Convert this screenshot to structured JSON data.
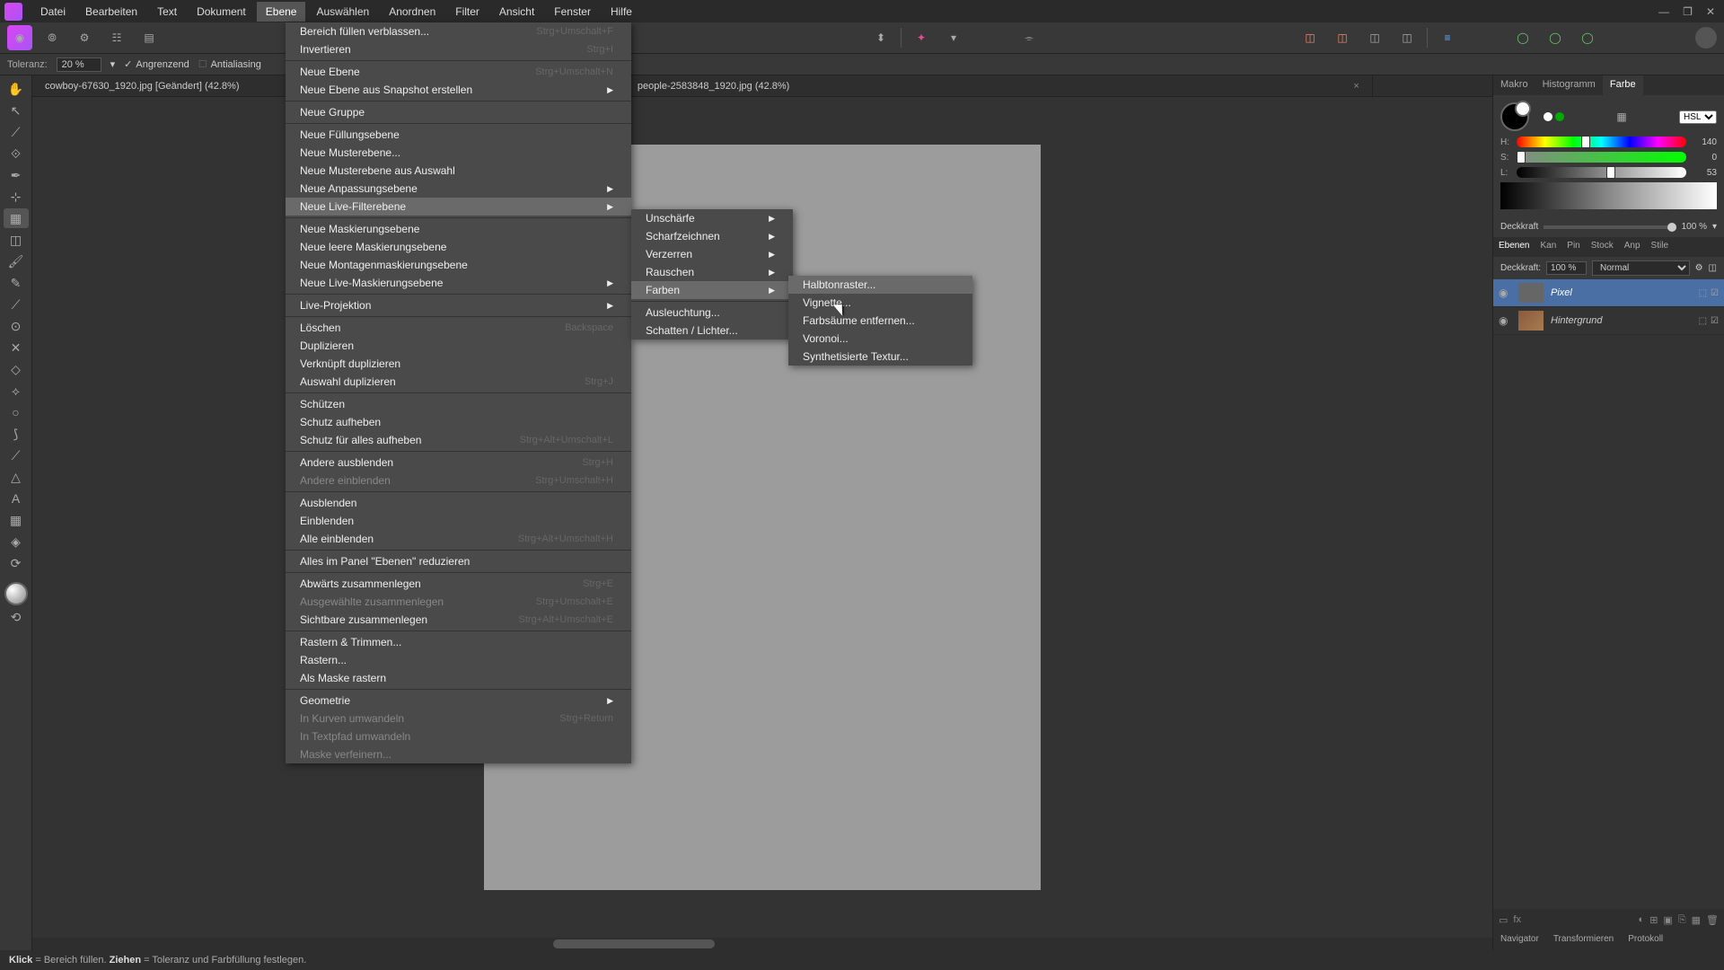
{
  "menubar": [
    "Datei",
    "Bearbeiten",
    "Text",
    "Dokument",
    "Ebene",
    "Auswählen",
    "Anordnen",
    "Filter",
    "Ansicht",
    "Fenster",
    "Hilfe"
  ],
  "active_menu_index": 4,
  "options": {
    "tolerance_label": "Toleranz:",
    "tolerance_value": "20 %",
    "contiguous": "Angrenzend",
    "antialias": "Antialiasing"
  },
  "tabs": [
    {
      "label": "cowboy-67630_1920.jpg [Geändert] (42.8%)"
    },
    {
      "label": "people-2583848_1920.jpg (42.8%)"
    }
  ],
  "right_tabs": [
    "Makro",
    "Histogramm",
    "Farbe"
  ],
  "color": {
    "mode": "HSL",
    "h": "140",
    "s": "0",
    "l": "53",
    "opacity_label": "Deckkraft",
    "opacity_value": "100 %"
  },
  "layer_tabs": [
    "Ebenen",
    "Kan",
    "Pin",
    "Stock",
    "Anp",
    "Stile"
  ],
  "layer_controls": {
    "opacity_label": "Deckkraft:",
    "opacity_value": "100 %",
    "blend": "Normal"
  },
  "layers": [
    {
      "name": "Pixel",
      "selected": true
    },
    {
      "name": "Hintergrund",
      "selected": false
    }
  ],
  "bottom_tabs": [
    "Navigator",
    "Transformieren",
    "Protokoll"
  ],
  "status": {
    "click": "Klick",
    "click_desc": "Bereich füllen.",
    "drag": "Ziehen",
    "drag_desc": "Toleranz und Farbfüllung festlegen."
  },
  "menu_ebene": [
    {
      "t": "item",
      "label": "Bereich füllen verblassen...",
      "sc": "Strg+Umschalt+F"
    },
    {
      "t": "item",
      "label": "Invertieren",
      "sc": "Strg+I"
    },
    {
      "t": "sep"
    },
    {
      "t": "item",
      "label": "Neue Ebene",
      "sc": "Strg+Umschalt+N"
    },
    {
      "t": "item",
      "label": "Neue Ebene aus Snapshot erstellen",
      "sub": true
    },
    {
      "t": "sep"
    },
    {
      "t": "item",
      "label": "Neue Gruppe"
    },
    {
      "t": "sep"
    },
    {
      "t": "item",
      "label": "Neue Füllungsebene"
    },
    {
      "t": "item",
      "label": "Neue Musterebene..."
    },
    {
      "t": "item",
      "label": "Neue Musterebene aus Auswahl"
    },
    {
      "t": "item",
      "label": "Neue Anpassungsebene",
      "sub": true
    },
    {
      "t": "item",
      "label": "Neue Live-Filterebene",
      "sub": true,
      "hov": true
    },
    {
      "t": "sep"
    },
    {
      "t": "item",
      "label": "Neue Maskierungsebene"
    },
    {
      "t": "item",
      "label": "Neue leere Maskierungsebene"
    },
    {
      "t": "item",
      "label": "Neue Montagenmaskierungsebene"
    },
    {
      "t": "item",
      "label": "Neue Live-Maskierungsebene",
      "sub": true
    },
    {
      "t": "sep"
    },
    {
      "t": "item",
      "label": "Live-Projektion",
      "sub": true
    },
    {
      "t": "sep"
    },
    {
      "t": "item",
      "label": "Löschen",
      "sc": "Backspace"
    },
    {
      "t": "item",
      "label": "Duplizieren"
    },
    {
      "t": "item",
      "label": "Verknüpft duplizieren"
    },
    {
      "t": "item",
      "label": "Auswahl duplizieren",
      "sc": "Strg+J"
    },
    {
      "t": "sep"
    },
    {
      "t": "item",
      "label": "Schützen"
    },
    {
      "t": "item",
      "label": "Schutz aufheben"
    },
    {
      "t": "item",
      "label": "Schutz für alles aufheben",
      "sc": "Strg+Alt+Umschalt+L"
    },
    {
      "t": "sep"
    },
    {
      "t": "item",
      "label": "Andere ausblenden",
      "sc": "Strg+H"
    },
    {
      "t": "item",
      "label": "Andere einblenden",
      "sc": "Strg+Umschalt+H",
      "disabled": true
    },
    {
      "t": "sep"
    },
    {
      "t": "item",
      "label": "Ausblenden"
    },
    {
      "t": "item",
      "label": "Einblenden"
    },
    {
      "t": "item",
      "label": "Alle einblenden",
      "sc": "Strg+Alt+Umschalt+H"
    },
    {
      "t": "sep"
    },
    {
      "t": "item",
      "label": "Alles im Panel \"Ebenen\" reduzieren"
    },
    {
      "t": "sep"
    },
    {
      "t": "item",
      "label": "Abwärts zusammenlegen",
      "sc": "Strg+E"
    },
    {
      "t": "item",
      "label": "Ausgewählte zusammenlegen",
      "sc": "Strg+Umschalt+E",
      "disabled": true
    },
    {
      "t": "item",
      "label": "Sichtbare zusammenlegen",
      "sc": "Strg+Alt+Umschalt+E"
    },
    {
      "t": "sep"
    },
    {
      "t": "item",
      "label": "Rastern & Trimmen..."
    },
    {
      "t": "item",
      "label": "Rastern..."
    },
    {
      "t": "item",
      "label": "Als Maske rastern"
    },
    {
      "t": "sep"
    },
    {
      "t": "item",
      "label": "Geometrie",
      "sub": true
    },
    {
      "t": "item",
      "label": "In Kurven umwandeln",
      "sc": "Strg+Return",
      "disabled": true
    },
    {
      "t": "item",
      "label": "In Textpfad umwandeln",
      "disabled": true
    },
    {
      "t": "item",
      "label": "Maske verfeinern...",
      "disabled": true
    }
  ],
  "submenu_filter": [
    {
      "t": "item",
      "label": "Unschärfe",
      "sub": true
    },
    {
      "t": "item",
      "label": "Scharfzeichnen",
      "sub": true
    },
    {
      "t": "item",
      "label": "Verzerren",
      "sub": true
    },
    {
      "t": "item",
      "label": "Rauschen",
      "sub": true
    },
    {
      "t": "item",
      "label": "Farben",
      "sub": true,
      "hov": true
    },
    {
      "t": "sep"
    },
    {
      "t": "item",
      "label": "Ausleuchtung..."
    },
    {
      "t": "item",
      "label": "Schatten / Lichter..."
    }
  ],
  "submenu_farben": [
    {
      "t": "item",
      "label": "Halbtonraster...",
      "hov": true
    },
    {
      "t": "item",
      "label": "Vignette..."
    },
    {
      "t": "item",
      "label": "Farbsäume entfernen..."
    },
    {
      "t": "item",
      "label": "Voronoi..."
    },
    {
      "t": "item",
      "label": "Synthetisierte Textur..."
    }
  ]
}
